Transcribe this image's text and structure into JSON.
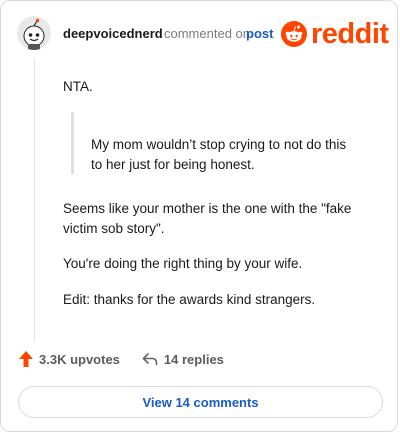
{
  "comment": {
    "username": "deepvoicednerd",
    "meta_text": "commented on",
    "post_link": "post",
    "logo_text": "reddit",
    "paragraphs": [
      "NTA.",
      "Seems like your mother is the one with the \"fake victim sob story\".",
      "You're doing the right thing by your wife.",
      "Edit: thanks for the awards kind strangers."
    ],
    "quote": "My mom wouldn’t stop crying to not do this to her just for being honest."
  },
  "actions": {
    "upvotes": "3.3K upvotes",
    "replies": "14 replies"
  },
  "view_comments_label": "View 14 comments",
  "colors": {
    "brand": "#ff4500",
    "link": "#1a5bc4",
    "upvote": "#ff4500"
  },
  "icons": [
    "reddit-alien-icon",
    "upvote-arrow-icon",
    "reply-arrow-icon"
  ]
}
